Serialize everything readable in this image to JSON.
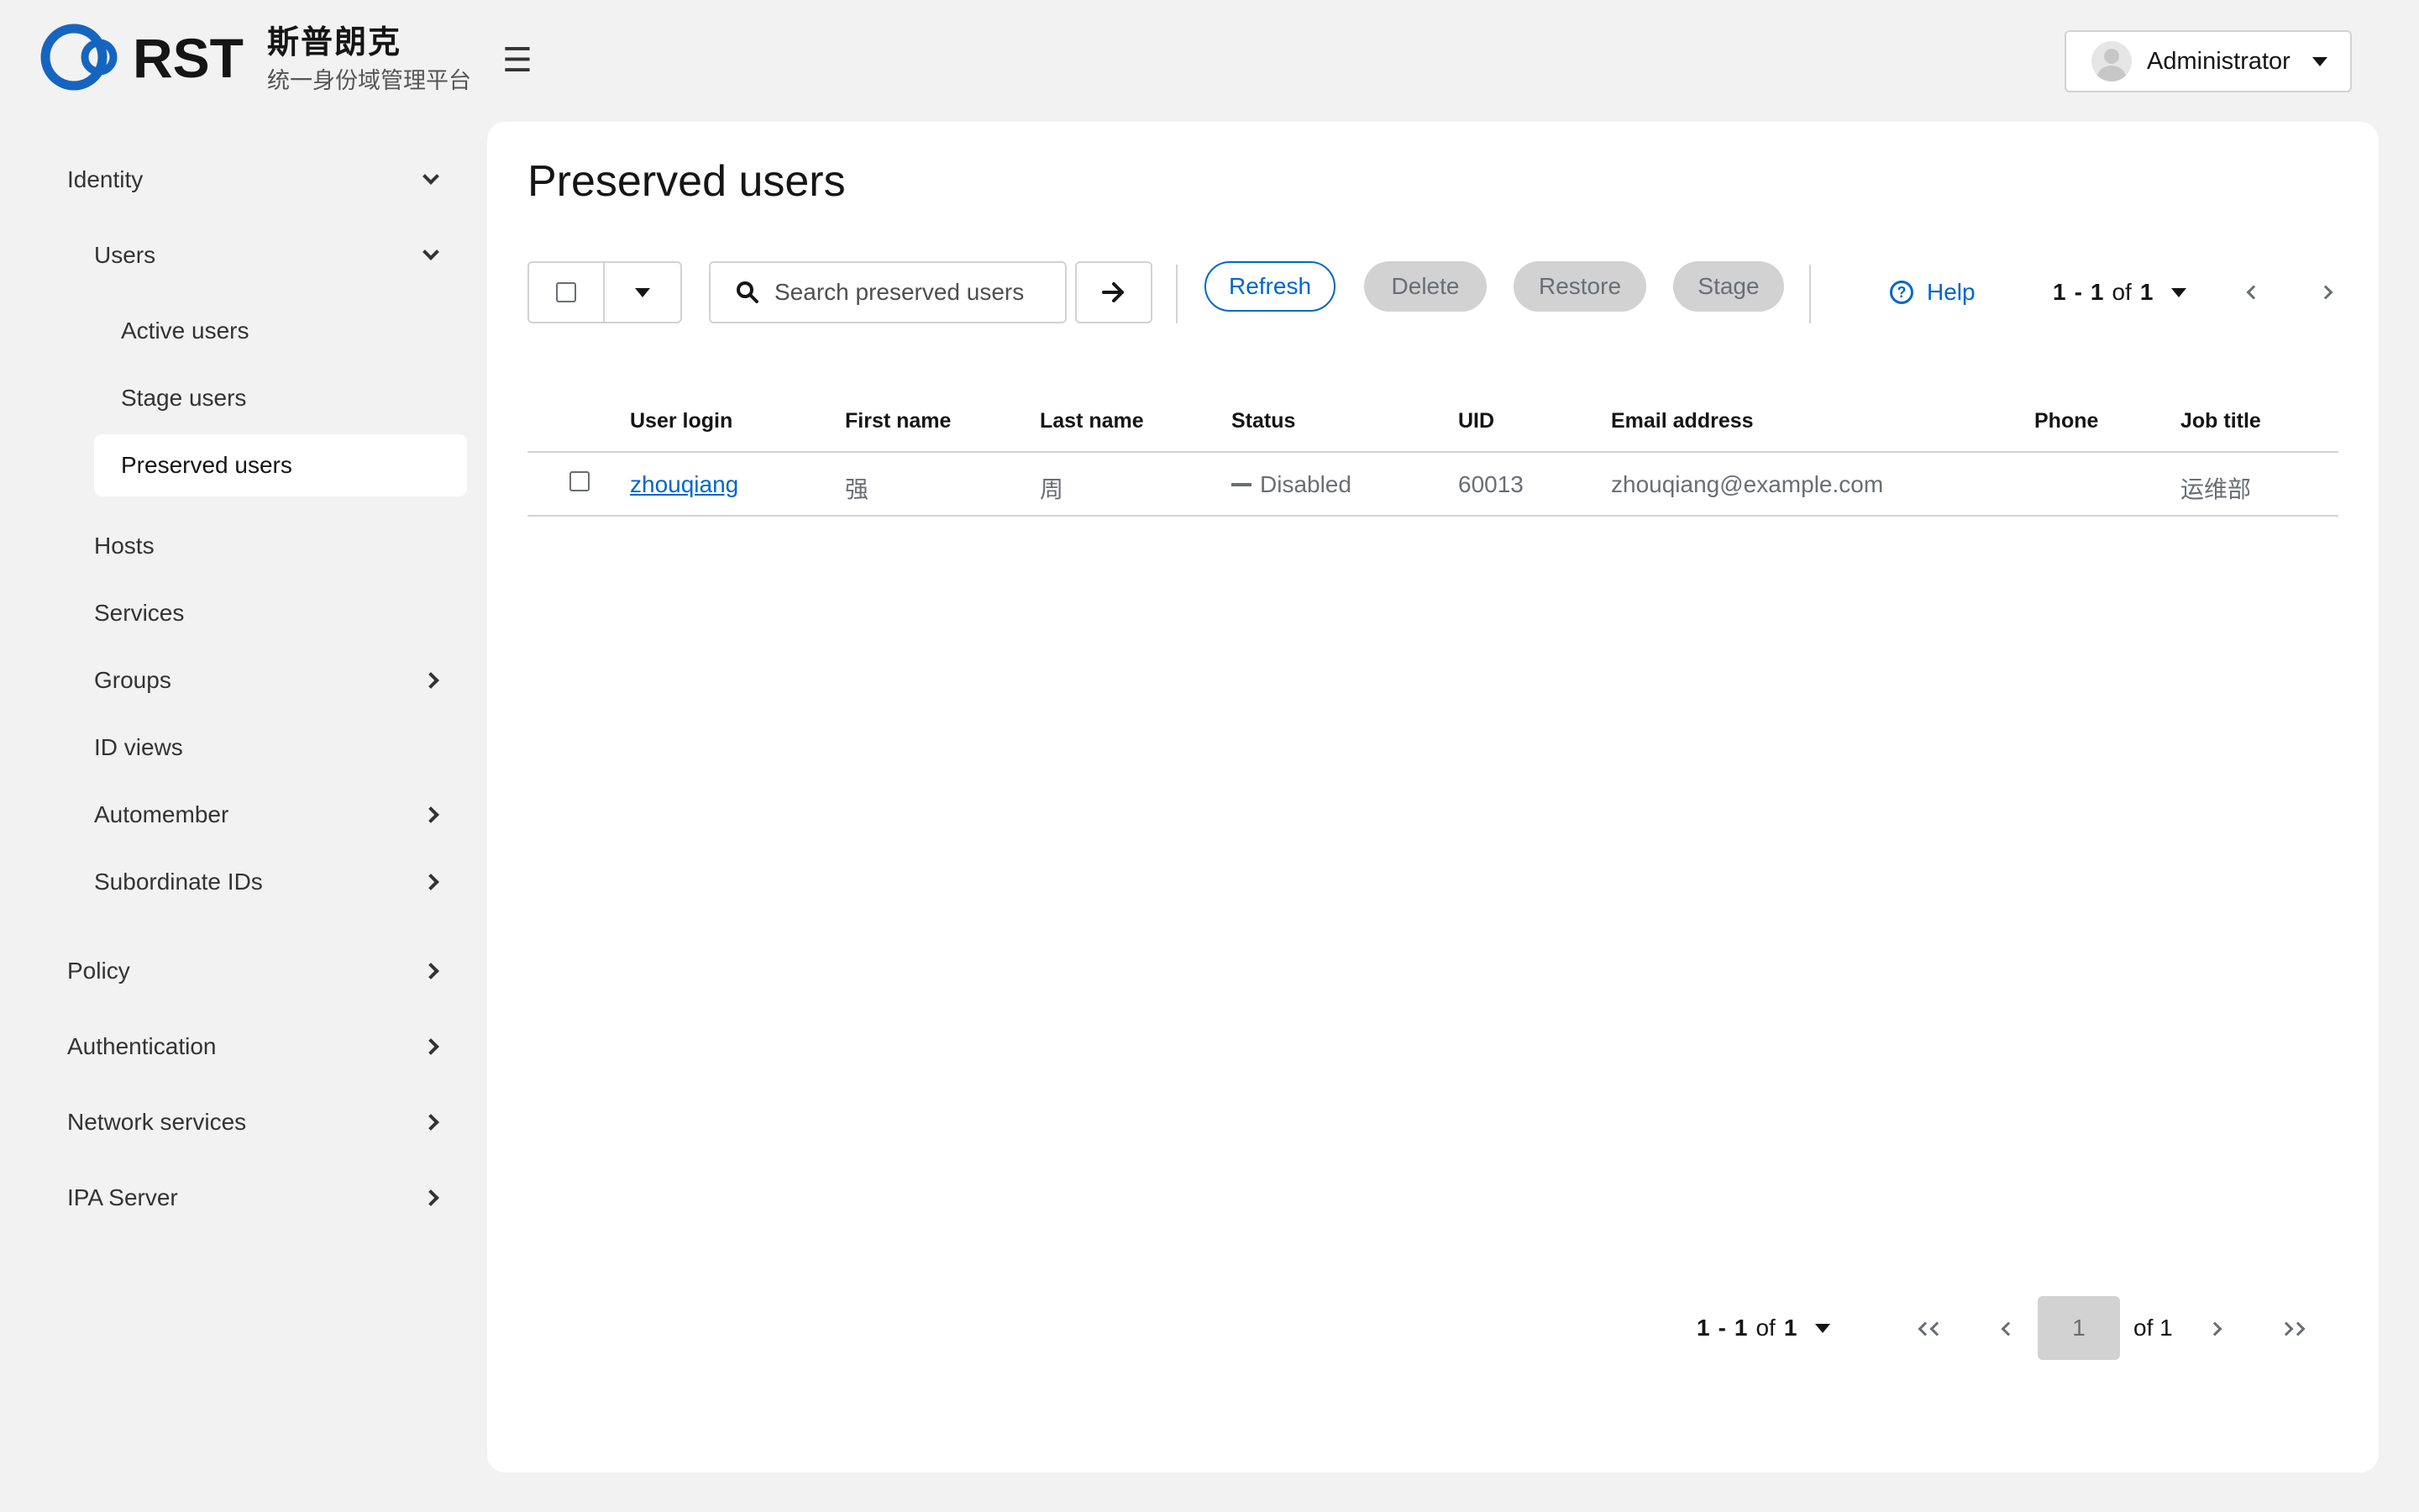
{
  "brand": {
    "logo_text": "RST",
    "title": "斯普朗克",
    "subtitle": "统一身份域管理平台",
    "accent": "#1565c0"
  },
  "header": {
    "menu_icon": "☰",
    "user_name": "Administrator"
  },
  "sidebar": {
    "identity": "Identity",
    "users": "Users",
    "active_users": "Active users",
    "stage_users": "Stage users",
    "preserved_users": "Preserved users",
    "hosts": "Hosts",
    "services": "Services",
    "groups": "Groups",
    "id_views": "ID views",
    "automember": "Automember",
    "subordinate_ids": "Subordinate IDs",
    "policy": "Policy",
    "authentication": "Authentication",
    "network_services": "Network services",
    "ipa_server": "IPA Server"
  },
  "main": {
    "title": "Preserved users",
    "search_placeholder": "Search preserved users",
    "refresh": "Refresh",
    "delete": "Delete",
    "restore": "Restore",
    "stage": "Stage",
    "help": "Help"
  },
  "pagination": {
    "start": "1",
    "dash": "-",
    "end": "1",
    "of_word": "of",
    "total": "1",
    "current_page": "1",
    "of_pages": "of 1"
  },
  "table": {
    "columns": {
      "user_login": "User login",
      "first_name": "First name",
      "last_name": "Last name",
      "status": "Status",
      "uid": "UID",
      "email": "Email address",
      "phone": "Phone",
      "job_title": "Job title"
    },
    "rows": [
      {
        "user_login": "zhouqiang",
        "first_name": "强",
        "last_name": "周",
        "status": "Disabled",
        "uid": "60013",
        "email": "zhouqiang@example.com",
        "phone": "",
        "job_title": "运维部"
      }
    ]
  },
  "colors": {
    "link": "#0066cc",
    "background": "#f2f2f2",
    "panel": "#ffffff",
    "border": "#d2d2d2",
    "muted_text": "#6a6e73"
  },
  "icons": {
    "menu": "hamburger-icon",
    "search": "search-icon",
    "go": "arrow-right-icon",
    "help": "help-circle-icon",
    "avatar": "user-avatar-icon"
  }
}
